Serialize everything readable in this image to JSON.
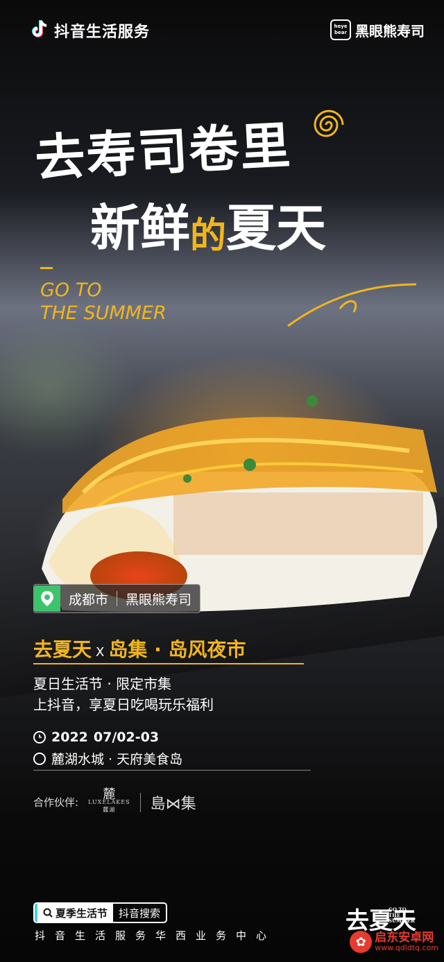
{
  "brand": {
    "left_label": "抖音生活服务",
    "right_label": "黑眼熊寿司",
    "bear_badge": "heye bear"
  },
  "headline": {
    "line1": "去寿司卷里",
    "line2_a": "新鲜",
    "line2_hl": "的",
    "line2_b": "夏天"
  },
  "slogan": {
    "line1": "GO TO",
    "line2": "THE SUMMER"
  },
  "location": {
    "city": "成都市",
    "shop": "黑眼熊寿司"
  },
  "event": {
    "part1": "去夏天",
    "x": "X",
    "part2": "岛集 · 岛风夜市",
    "sub1": "夏日生活节 · 限定市集",
    "sub2": "上抖音，享夏日吃喝玩乐福利",
    "date_year": "2022",
    "date_range": "07/02-03",
    "place": "麓湖水城 · 天府美食岛"
  },
  "partners": {
    "label": "合作伙伴:",
    "lux_cn": "麓",
    "lux_en": "LUXELAKES",
    "lux_small": "麓湖",
    "island": "島⋈集"
  },
  "footer": {
    "search_tag": "夏季生活节",
    "search_text": "抖音搜索",
    "org": "抖音生活服务华西业务中心",
    "sign": "去夏天",
    "sign_mini": "GO TO THE SUMMER"
  },
  "watermark": {
    "name": "启东安卓网",
    "url": "www.qdldtq.com"
  },
  "colors": {
    "accent": "#f2b61c",
    "pin": "#3cc36b",
    "watermark": "#e63b2e",
    "search_bracket": "#41d4e8"
  }
}
